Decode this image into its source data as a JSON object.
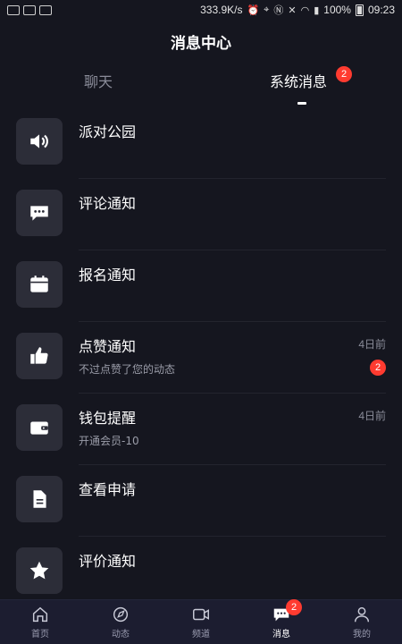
{
  "status_bar": {
    "speed": "333.9K/s",
    "battery": "100%",
    "time": "09:23"
  },
  "header": {
    "title": "消息中心"
  },
  "tabs": [
    {
      "label": "聊天",
      "active": false
    },
    {
      "label": "系统消息",
      "active": true,
      "badge": "2"
    }
  ],
  "items": [
    {
      "icon": "speaker-icon",
      "title": "派对公园",
      "sub": "",
      "time": "",
      "badge": ""
    },
    {
      "icon": "comment-icon",
      "title": "评论通知",
      "sub": "",
      "time": "",
      "badge": ""
    },
    {
      "icon": "calendar-icon",
      "title": "报名通知",
      "sub": "",
      "time": "",
      "badge": ""
    },
    {
      "icon": "thumbs-up-icon",
      "title": "点赞通知",
      "sub": "不过点赞了您的动态",
      "time": "4日前",
      "badge": "2"
    },
    {
      "icon": "wallet-icon",
      "title": "钱包提醒",
      "sub": "开通会员-10",
      "time": "4日前",
      "badge": ""
    },
    {
      "icon": "document-icon",
      "title": "查看申请",
      "sub": "",
      "time": "",
      "badge": ""
    },
    {
      "icon": "star-icon",
      "title": "评价通知",
      "sub": "",
      "time": "",
      "badge": ""
    }
  ],
  "bottom_nav": [
    {
      "label": "首页",
      "icon": "home-icon"
    },
    {
      "label": "动态",
      "icon": "explore-icon"
    },
    {
      "label": "频道",
      "icon": "video-icon"
    },
    {
      "label": "消息",
      "icon": "message-icon",
      "badge": "2",
      "active": true
    },
    {
      "label": "我的",
      "icon": "profile-icon"
    }
  ],
  "colors": {
    "background": "#15161f",
    "badge": "#ff3b30",
    "nav_bg": "#1c1d30"
  }
}
